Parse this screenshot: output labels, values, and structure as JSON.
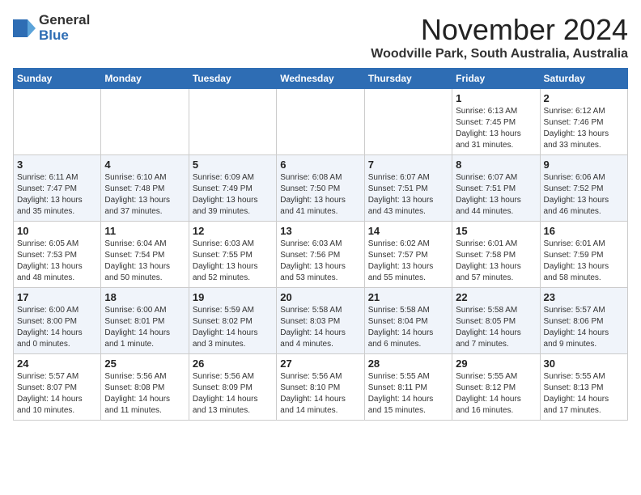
{
  "header": {
    "logo_general": "General",
    "logo_blue": "Blue",
    "month_title": "November 2024",
    "location": "Woodville Park, South Australia, Australia"
  },
  "days_of_week": [
    "Sunday",
    "Monday",
    "Tuesday",
    "Wednesday",
    "Thursday",
    "Friday",
    "Saturday"
  ],
  "weeks": [
    [
      {
        "day": "",
        "text": ""
      },
      {
        "day": "",
        "text": ""
      },
      {
        "day": "",
        "text": ""
      },
      {
        "day": "",
        "text": ""
      },
      {
        "day": "",
        "text": ""
      },
      {
        "day": "1",
        "text": "Sunrise: 6:13 AM\nSunset: 7:45 PM\nDaylight: 13 hours\nand 31 minutes."
      },
      {
        "day": "2",
        "text": "Sunrise: 6:12 AM\nSunset: 7:46 PM\nDaylight: 13 hours\nand 33 minutes."
      }
    ],
    [
      {
        "day": "3",
        "text": "Sunrise: 6:11 AM\nSunset: 7:47 PM\nDaylight: 13 hours\nand 35 minutes."
      },
      {
        "day": "4",
        "text": "Sunrise: 6:10 AM\nSunset: 7:48 PM\nDaylight: 13 hours\nand 37 minutes."
      },
      {
        "day": "5",
        "text": "Sunrise: 6:09 AM\nSunset: 7:49 PM\nDaylight: 13 hours\nand 39 minutes."
      },
      {
        "day": "6",
        "text": "Sunrise: 6:08 AM\nSunset: 7:50 PM\nDaylight: 13 hours\nand 41 minutes."
      },
      {
        "day": "7",
        "text": "Sunrise: 6:07 AM\nSunset: 7:51 PM\nDaylight: 13 hours\nand 43 minutes."
      },
      {
        "day": "8",
        "text": "Sunrise: 6:07 AM\nSunset: 7:51 PM\nDaylight: 13 hours\nand 44 minutes."
      },
      {
        "day": "9",
        "text": "Sunrise: 6:06 AM\nSunset: 7:52 PM\nDaylight: 13 hours\nand 46 minutes."
      }
    ],
    [
      {
        "day": "10",
        "text": "Sunrise: 6:05 AM\nSunset: 7:53 PM\nDaylight: 13 hours\nand 48 minutes."
      },
      {
        "day": "11",
        "text": "Sunrise: 6:04 AM\nSunset: 7:54 PM\nDaylight: 13 hours\nand 50 minutes."
      },
      {
        "day": "12",
        "text": "Sunrise: 6:03 AM\nSunset: 7:55 PM\nDaylight: 13 hours\nand 52 minutes."
      },
      {
        "day": "13",
        "text": "Sunrise: 6:03 AM\nSunset: 7:56 PM\nDaylight: 13 hours\nand 53 minutes."
      },
      {
        "day": "14",
        "text": "Sunrise: 6:02 AM\nSunset: 7:57 PM\nDaylight: 13 hours\nand 55 minutes."
      },
      {
        "day": "15",
        "text": "Sunrise: 6:01 AM\nSunset: 7:58 PM\nDaylight: 13 hours\nand 57 minutes."
      },
      {
        "day": "16",
        "text": "Sunrise: 6:01 AM\nSunset: 7:59 PM\nDaylight: 13 hours\nand 58 minutes."
      }
    ],
    [
      {
        "day": "17",
        "text": "Sunrise: 6:00 AM\nSunset: 8:00 PM\nDaylight: 14 hours\nand 0 minutes."
      },
      {
        "day": "18",
        "text": "Sunrise: 6:00 AM\nSunset: 8:01 PM\nDaylight: 14 hours\nand 1 minute."
      },
      {
        "day": "19",
        "text": "Sunrise: 5:59 AM\nSunset: 8:02 PM\nDaylight: 14 hours\nand 3 minutes."
      },
      {
        "day": "20",
        "text": "Sunrise: 5:58 AM\nSunset: 8:03 PM\nDaylight: 14 hours\nand 4 minutes."
      },
      {
        "day": "21",
        "text": "Sunrise: 5:58 AM\nSunset: 8:04 PM\nDaylight: 14 hours\nand 6 minutes."
      },
      {
        "day": "22",
        "text": "Sunrise: 5:58 AM\nSunset: 8:05 PM\nDaylight: 14 hours\nand 7 minutes."
      },
      {
        "day": "23",
        "text": "Sunrise: 5:57 AM\nSunset: 8:06 PM\nDaylight: 14 hours\nand 9 minutes."
      }
    ],
    [
      {
        "day": "24",
        "text": "Sunrise: 5:57 AM\nSunset: 8:07 PM\nDaylight: 14 hours\nand 10 minutes."
      },
      {
        "day": "25",
        "text": "Sunrise: 5:56 AM\nSunset: 8:08 PM\nDaylight: 14 hours\nand 11 minutes."
      },
      {
        "day": "26",
        "text": "Sunrise: 5:56 AM\nSunset: 8:09 PM\nDaylight: 14 hours\nand 13 minutes."
      },
      {
        "day": "27",
        "text": "Sunrise: 5:56 AM\nSunset: 8:10 PM\nDaylight: 14 hours\nand 14 minutes."
      },
      {
        "day": "28",
        "text": "Sunrise: 5:55 AM\nSunset: 8:11 PM\nDaylight: 14 hours\nand 15 minutes."
      },
      {
        "day": "29",
        "text": "Sunrise: 5:55 AM\nSunset: 8:12 PM\nDaylight: 14 hours\nand 16 minutes."
      },
      {
        "day": "30",
        "text": "Sunrise: 5:55 AM\nSunset: 8:13 PM\nDaylight: 14 hours\nand 17 minutes."
      }
    ]
  ]
}
